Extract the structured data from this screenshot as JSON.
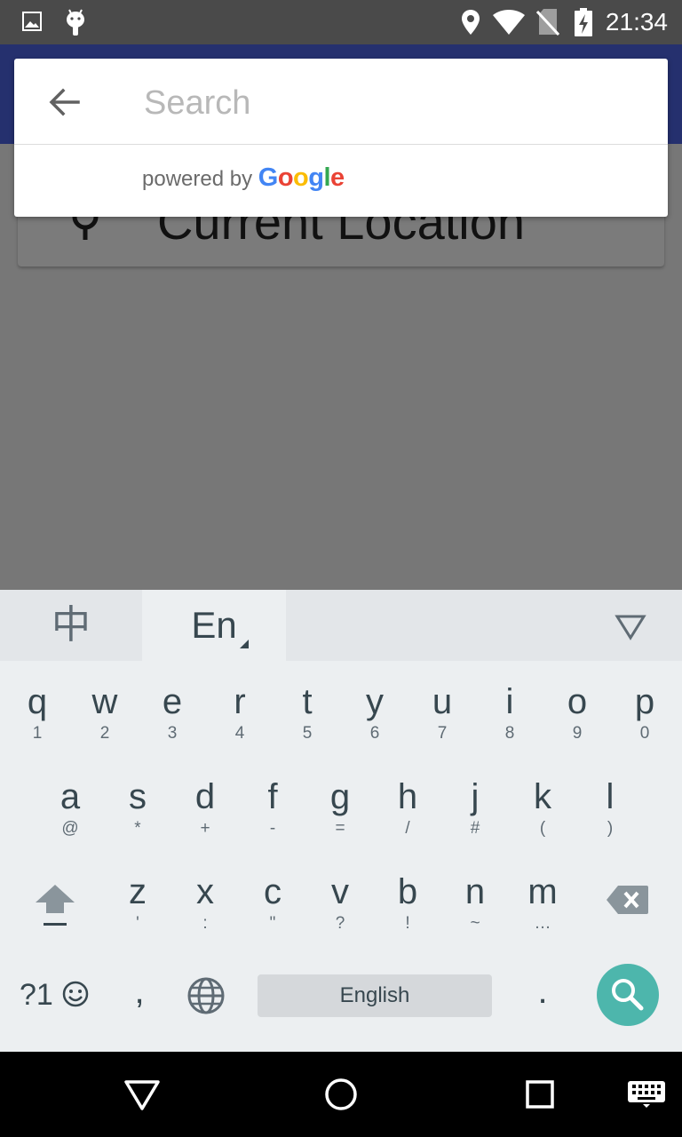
{
  "status_bar": {
    "time": "21:34",
    "left_icons": [
      "image-icon",
      "android-debug-icon"
    ],
    "right_icons": [
      "location-icon",
      "wifi-icon",
      "no-sim-icon",
      "battery-charging-icon"
    ]
  },
  "background": {
    "current_location_label": "Current Location",
    "current_location_icon": "location-pin-icon"
  },
  "search": {
    "placeholder": "Search",
    "value": "",
    "back_icon": "arrow-back-icon",
    "powered_by_prefix": "powered by",
    "google_letters": [
      "G",
      "o",
      "o",
      "g",
      "l",
      "e"
    ],
    "google_colors": [
      "#4285F4",
      "#EA4335",
      "#FBBC05",
      "#4285F4",
      "#34A853",
      "#EA4335"
    ]
  },
  "keyboard": {
    "tab_chinese": "中",
    "tab_english": "En",
    "rows": [
      [
        {
          "k": "q",
          "s": "1"
        },
        {
          "k": "w",
          "s": "2"
        },
        {
          "k": "e",
          "s": "3"
        },
        {
          "k": "r",
          "s": "4"
        },
        {
          "k": "t",
          "s": "5"
        },
        {
          "k": "y",
          "s": "6"
        },
        {
          "k": "u",
          "s": "7"
        },
        {
          "k": "i",
          "s": "8"
        },
        {
          "k": "o",
          "s": "9"
        },
        {
          "k": "p",
          "s": "0"
        }
      ],
      [
        {
          "k": "a",
          "s": "@"
        },
        {
          "k": "s",
          "s": "*"
        },
        {
          "k": "d",
          "s": "+"
        },
        {
          "k": "f",
          "s": "-"
        },
        {
          "k": "g",
          "s": "="
        },
        {
          "k": "h",
          "s": "/"
        },
        {
          "k": "j",
          "s": "#"
        },
        {
          "k": "k",
          "s": "("
        },
        {
          "k": "l",
          "s": ")"
        }
      ],
      [
        {
          "k": "z",
          "s": "'"
        },
        {
          "k": "x",
          "s": ":"
        },
        {
          "k": "c",
          "s": "\""
        },
        {
          "k": "v",
          "s": "?"
        },
        {
          "k": "b",
          "s": "!"
        },
        {
          "k": "n",
          "s": "~"
        },
        {
          "k": "m",
          "s": "…"
        }
      ]
    ],
    "symbols_label": "?1",
    "comma": ",",
    "period": ".",
    "space_label": "English",
    "accent_color": "#4db6ac"
  },
  "nav_bar": {
    "buttons": [
      "back-icon",
      "home-icon",
      "recents-icon",
      "keyboard-switch-icon"
    ]
  }
}
